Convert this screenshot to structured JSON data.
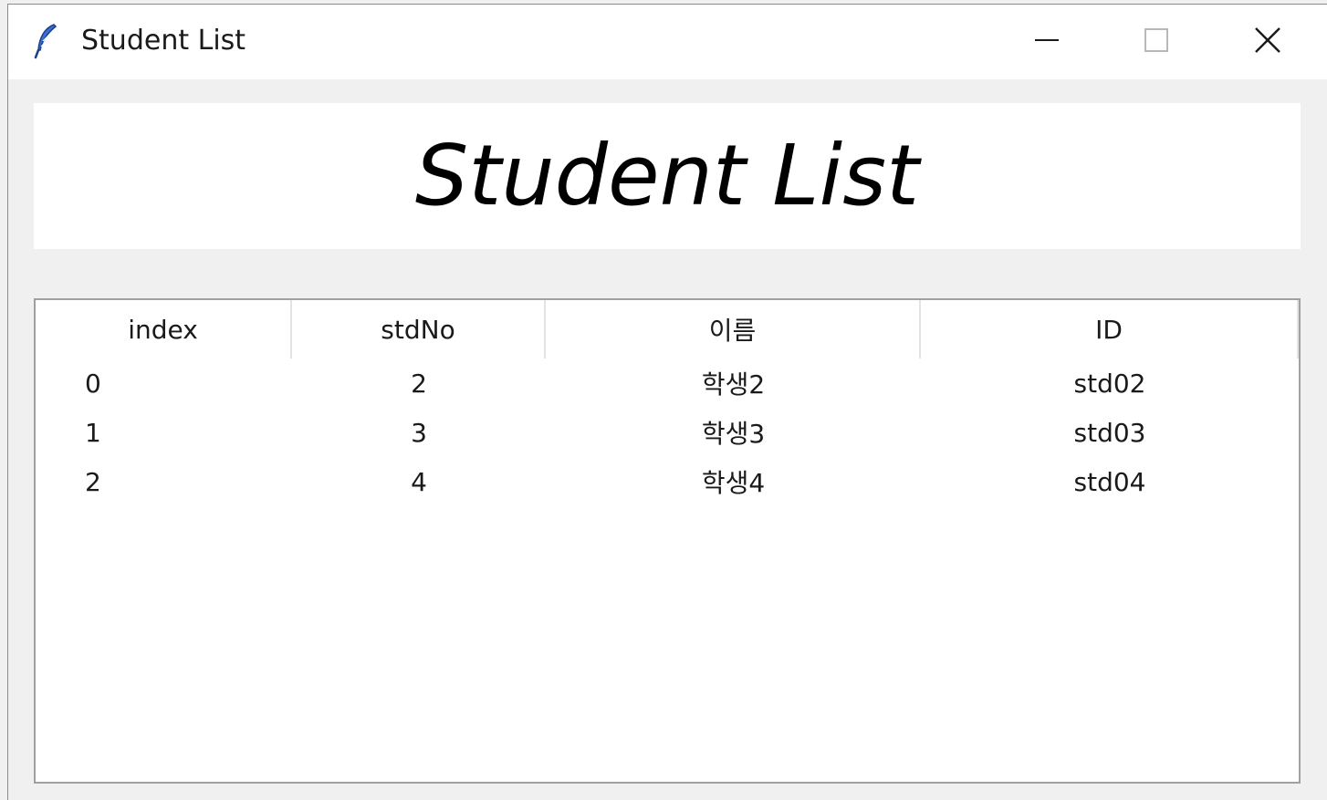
{
  "window": {
    "title": "Student List",
    "icon": "feather-icon",
    "controls": {
      "minimize": "minimize-icon",
      "maximize": "maximize-icon",
      "close": "close-icon"
    }
  },
  "header": {
    "title": "Student List"
  },
  "table": {
    "columns": [
      "index",
      "stdNo",
      "이름",
      "ID"
    ],
    "rows": [
      [
        "0",
        "2",
        "학생2",
        "std02"
      ],
      [
        "1",
        "3",
        "학생3",
        "std03"
      ],
      [
        "2",
        "4",
        "학생4",
        "std04"
      ]
    ]
  }
}
